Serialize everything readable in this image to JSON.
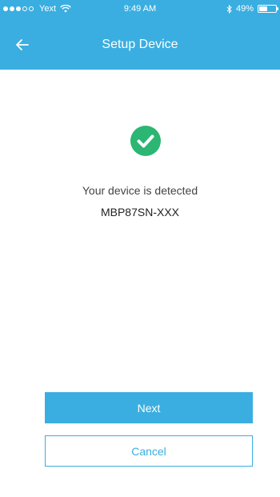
{
  "status_bar": {
    "carrier": "Yext",
    "time": "9:49 AM",
    "battery_percent": "49%",
    "battery_level": 0.49,
    "signal_bars": 3,
    "signal_total": 5,
    "icons": [
      "wifi-icon",
      "bluetooth-icon",
      "battery-icon"
    ]
  },
  "nav": {
    "title": "Setup Device",
    "back_icon": "back-arrow-icon"
  },
  "content": {
    "status_icon": "check-circle-icon",
    "detected_text": "Your device is detected",
    "device_name": "MBP87SN-XXX"
  },
  "actions": {
    "next_label": "Next",
    "cancel_label": "Cancel"
  },
  "colors": {
    "accent": "#3aaee0",
    "success": "#2bb673",
    "text": "#444444"
  }
}
